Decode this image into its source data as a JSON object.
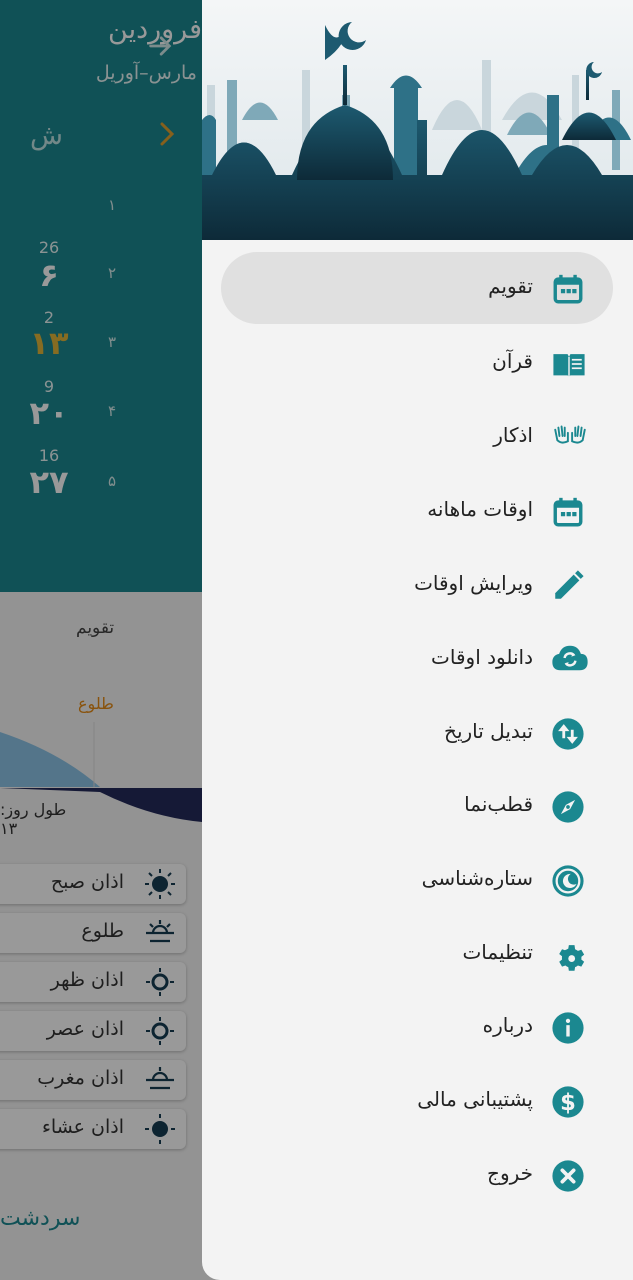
{
  "background": {
    "month_title": "فروردین",
    "month_subtitle": "مارس–آوریل",
    "weekday_header": "ش",
    "week_numbers": [
      "۱",
      "۲",
      "۳",
      "۴",
      "۵"
    ],
    "days": [
      {
        "gregorian": "26",
        "persian": "۶"
      },
      {
        "gregorian": "2",
        "persian": "۱۳"
      },
      {
        "gregorian": "9",
        "persian": "۲۰"
      },
      {
        "gregorian": "16",
        "persian": "۲۷"
      }
    ],
    "tab_label": "تقویم",
    "sunrise_label": "طلوع",
    "day_length": "طول روز: ۱۳",
    "prayers": [
      "اذان صبح",
      "طلوع",
      "اذان ظهر",
      "اذان عصر",
      "اذان مغرب",
      "اذان عشاء"
    ],
    "city": "سردشت"
  },
  "drawer": {
    "items": [
      {
        "label": "تقویم",
        "icon": "calendar-icon",
        "active": true
      },
      {
        "label": "قرآن",
        "icon": "quran-book-icon",
        "active": false
      },
      {
        "label": "اذکار",
        "icon": "praying-hands-icon",
        "active": false
      },
      {
        "label": "اوقات ماهانه",
        "icon": "monthly-calendar-icon",
        "active": false
      },
      {
        "label": "ویرایش اوقات",
        "icon": "pencil-icon",
        "active": false
      },
      {
        "label": "دانلود اوقات",
        "icon": "cloud-sync-icon",
        "active": false
      },
      {
        "label": "تبدیل تاریخ",
        "icon": "swap-vertical-icon",
        "active": false
      },
      {
        "label": "قطب‌نما",
        "icon": "compass-icon",
        "active": false
      },
      {
        "label": "ستاره‌شناسی",
        "icon": "astronomy-icon",
        "active": false
      },
      {
        "label": "تنظیمات",
        "icon": "gear-icon",
        "active": false
      },
      {
        "label": "درباره",
        "icon": "info-icon",
        "active": false
      },
      {
        "label": "پشتیبانی مالی",
        "icon": "dollar-icon",
        "active": false
      },
      {
        "label": "خروج",
        "icon": "close-circle-icon",
        "active": false
      }
    ]
  },
  "colors": {
    "accent": "#1b8890",
    "drawer_background": "#f3f3f3",
    "active_item": "#e0e0e0",
    "sunrise_orange": "#e48b17"
  }
}
